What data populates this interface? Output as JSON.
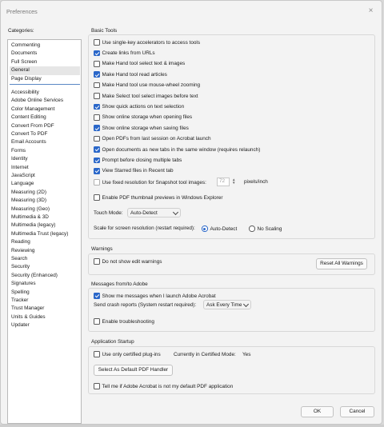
{
  "window": {
    "title": "Preferences",
    "close_glyph": "×"
  },
  "categories": {
    "label": "Categories:",
    "top_items": [
      "Commenting",
      "Documents",
      "Full Screen",
      "General",
      "Page Display"
    ],
    "selected": "General",
    "items": [
      "Accessibility",
      "Adobe Online Services",
      "Color Management",
      "Content Editing",
      "Convert From PDF",
      "Convert To PDF",
      "Email Accounts",
      "Forms",
      "Identity",
      "Internet",
      "JavaScript",
      "Language",
      "Measuring (2D)",
      "Measuring (3D)",
      "Measuring (Geo)",
      "Multimedia & 3D",
      "Multimedia (legacy)",
      "Multimedia Trust (legacy)",
      "Reading",
      "Reviewing",
      "Search",
      "Security",
      "Security (Enhanced)",
      "Signatures",
      "Spelling",
      "Tracker",
      "Trust Manager",
      "Units & Guides",
      "Updater"
    ]
  },
  "basic_tools": {
    "title": "Basic Tools",
    "options": [
      {
        "label": "Use single-key accelerators to access tools",
        "checked": false
      },
      {
        "label": "Create links from URLs",
        "checked": true
      },
      {
        "label": "Make Hand tool select text & images",
        "checked": false
      },
      {
        "label": "Make Hand tool read articles",
        "checked": true
      },
      {
        "label": "Make Hand tool use mouse-wheel zooming",
        "checked": false
      },
      {
        "label": "Make Select tool select images before text",
        "checked": false
      },
      {
        "label": "Show quick actions on text selection",
        "checked": true
      },
      {
        "label": "Show online storage when opening files",
        "checked": false
      },
      {
        "label": "Show online storage when saving files",
        "checked": true
      },
      {
        "label": "Open PDFs from last session on Acrobat launch",
        "checked": false
      },
      {
        "label": "Open documents as new tabs in the same window (requires relaunch)",
        "checked": true
      },
      {
        "label": "Prompt before closing multiple tabs",
        "checked": true
      },
      {
        "label": "View Starred files in Recent tab",
        "checked": true
      }
    ],
    "snapshot_label": "Use fixed resolution for Snapshot tool images:",
    "snapshot_checked": false,
    "snapshot_value": "72",
    "snapshot_unit": "pixels/inch",
    "thumbnail_label": "Enable PDF thumbnail previews in Windows Explorer",
    "thumbnail_checked": false,
    "touch_mode_label": "Touch Mode:",
    "touch_mode_value": "Auto-Detect",
    "scale_label": "Scale for screen resolution (restart required):",
    "scale_options": [
      "Auto-Detect",
      "No Scaling"
    ],
    "scale_selected": "Auto-Detect"
  },
  "warnings": {
    "title": "Warnings",
    "dont_show_label": "Do not show edit warnings",
    "dont_show_checked": false,
    "reset_button": "Reset All Warnings"
  },
  "messages": {
    "title": "Messages from/to Adobe",
    "show_messages_label": "Show me messages when I launch Adobe Acrobat",
    "show_messages_checked": true,
    "crash_label": "Send crash reports (System restart required):",
    "crash_value": "Ask Every Time",
    "troubleshoot_label": "Enable troubleshooting",
    "troubleshoot_checked": false
  },
  "startup": {
    "title": "Application Startup",
    "certified_label": "Use only certified plug-ins",
    "certified_checked": false,
    "certified_mode_label": "Currently in Certified Mode:",
    "certified_mode_value": "Yes",
    "default_button": "Select As Default PDF Handler",
    "tell_me_label": "Tell me if Adobe Acrobat is not my default PDF application",
    "tell_me_checked": false
  },
  "footer": {
    "ok": "OK",
    "cancel": "Cancel"
  }
}
